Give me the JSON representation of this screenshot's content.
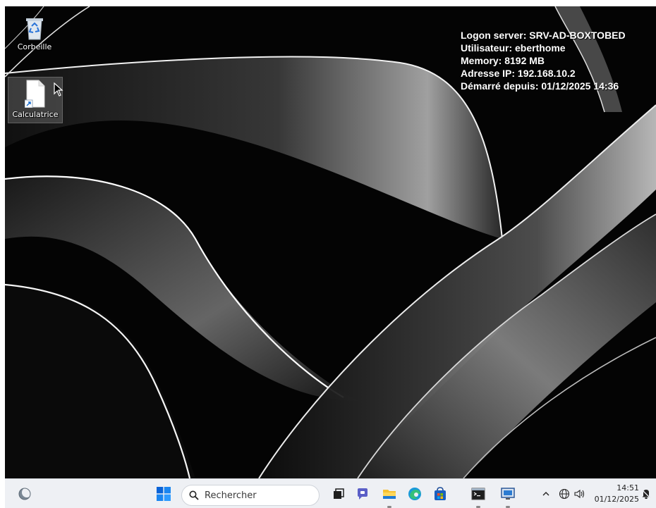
{
  "desktop": {
    "icons": [
      {
        "label": "Corbeille"
      },
      {
        "label": "Calculatrice"
      }
    ],
    "bginfo": {
      "lines": [
        "Logon server: SRV-AD-BOXTOBED",
        "Utilisateur: eberthome",
        "Memory: 8192 MB",
        "Adresse IP: 192.168.10.2",
        "Démarré depuis: 01/12/2025 14:36"
      ]
    }
  },
  "taskbar": {
    "widgets_icon": "weather-widget-icon",
    "start_icon": "windows-start-icon",
    "search": {
      "placeholder": "Rechercher"
    },
    "apps": [
      {
        "icon": "task-view-icon",
        "running": false
      },
      {
        "icon": "chat-icon",
        "running": false
      },
      {
        "icon": "file-explorer-icon",
        "running": true
      },
      {
        "icon": "edge-icon",
        "running": false
      },
      {
        "icon": "store-icon",
        "running": false
      },
      {
        "icon": "terminal-icon",
        "running": true
      },
      {
        "icon": "remote-desktop-icon",
        "running": true
      }
    ],
    "tray": {
      "time": "14:51",
      "date": "01/12/2025"
    }
  },
  "colors": {
    "taskbar_bg": "#eef0f4",
    "start_blue": "#0a64d8",
    "accent_yellow": "#f6c133"
  }
}
